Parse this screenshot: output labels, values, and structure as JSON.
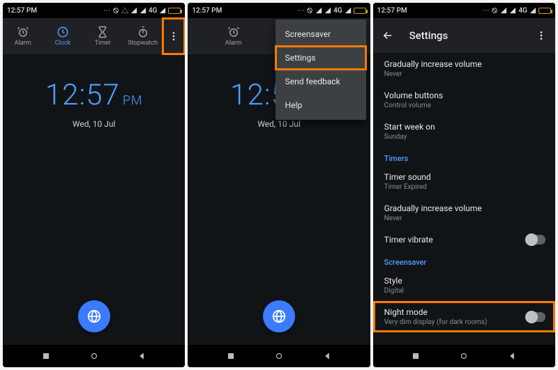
{
  "status": {
    "time": "12:57 PM",
    "net": "4G"
  },
  "tabs": {
    "alarm": "Alarm",
    "clock": "Clock",
    "timer": "Timer",
    "stopwatch": "Stopwatch"
  },
  "clock": {
    "time": "12:57",
    "ampm": "PM",
    "date": "Wed, 10 Jul"
  },
  "menu": {
    "screensaver": "Screensaver",
    "settings": "Settings",
    "feedback": "Send feedback",
    "help": "Help"
  },
  "settings": {
    "title": "Settings",
    "gradual": {
      "label": "Gradually increase volume",
      "value": "Never"
    },
    "volbuttons": {
      "label": "Volume buttons",
      "value": "Control volume"
    },
    "startweek": {
      "label": "Start week on",
      "value": "Sunday"
    },
    "timersHeader": "Timers",
    "timersound": {
      "label": "Timer sound",
      "value": "Timer Expired"
    },
    "gradual2": {
      "label": "Gradually increase volume",
      "value": "Never"
    },
    "timervibrate": {
      "label": "Timer vibrate"
    },
    "screensaverHeader": "Screensaver",
    "style": {
      "label": "Style",
      "value": "Digital"
    },
    "nightmode": {
      "label": "Night mode",
      "value": "Very dim display (for dark rooms)"
    }
  }
}
